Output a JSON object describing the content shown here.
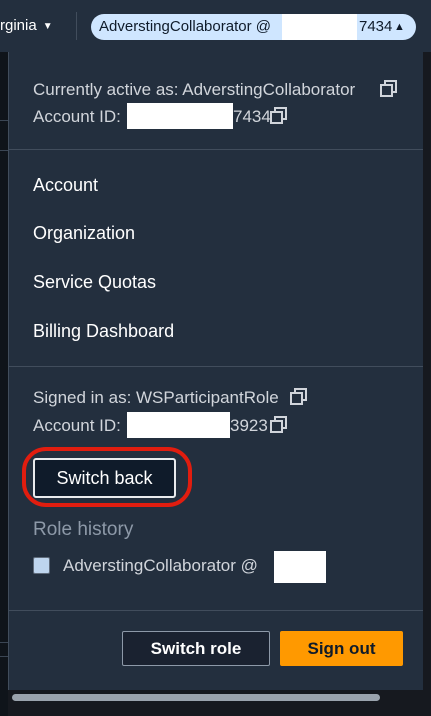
{
  "topbar": {
    "region_label": "rginia",
    "region_caret": "▼",
    "account_label": "AdverstingCollaborator @ ",
    "account_suffix": "7434",
    "account_caret": "▲"
  },
  "current": {
    "active_as": "Currently active as: AdverstingCollaborator",
    "account_id_label": "Account ID:",
    "account_id_suffix": "7434"
  },
  "menu": {
    "items": [
      {
        "label": "Account"
      },
      {
        "label": "Organization"
      },
      {
        "label": "Service Quotas"
      },
      {
        "label": "Billing Dashboard"
      }
    ]
  },
  "signed_in": {
    "signed_in_as": "Signed in as: WSParticipantRole",
    "account_id_label": "Account ID:",
    "account_id_suffix": "3923"
  },
  "switch_back": {
    "label": "Switch back"
  },
  "role_history": {
    "title": "Role history",
    "items": [
      {
        "label": "AdverstingCollaborator @"
      }
    ]
  },
  "footer": {
    "switch_role_label": "Switch role",
    "sign_out_label": "Sign out"
  },
  "colors": {
    "panel_bg": "#232f3e",
    "primary_button": "#ff9900",
    "highlight": "#e11d0f",
    "account_pill": "#cfe6ff"
  },
  "icons": [
    "copy-icon",
    "caret-down-icon",
    "caret-up-icon"
  ]
}
